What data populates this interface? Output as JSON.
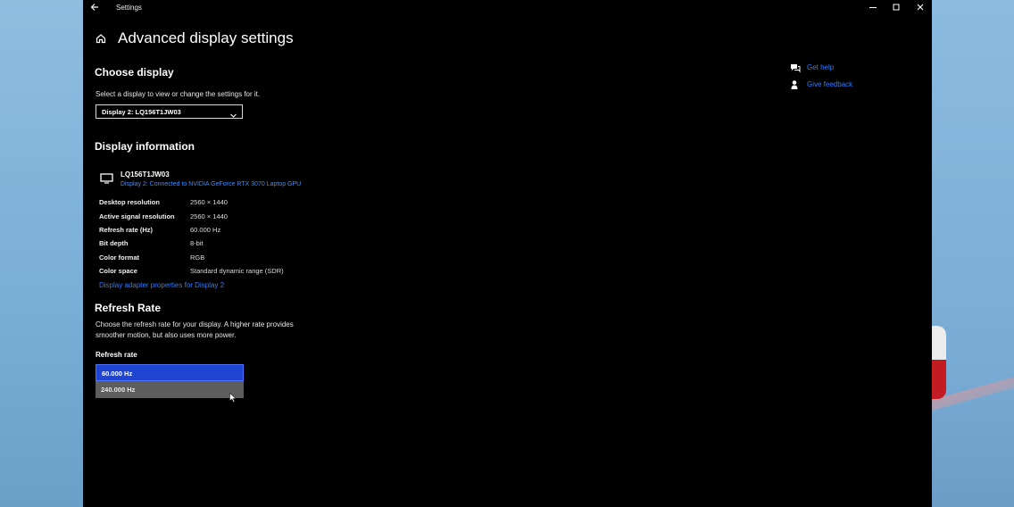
{
  "window": {
    "title": "Settings"
  },
  "page": {
    "title": "Advanced display settings"
  },
  "choose_display": {
    "heading": "Choose display",
    "instruction": "Select a display to view or change the settings for it.",
    "selected": "Display 2: LQ156T1JW03"
  },
  "display_info": {
    "heading": "Display information",
    "monitor_name": "LQ156T1JW03",
    "connection": "Display 2: Connected to NVIDIA GeForce RTX 3070 Laptop GPU",
    "rows": [
      {
        "label": "Desktop resolution",
        "value": "2560 × 1440"
      },
      {
        "label": "Active signal resolution",
        "value": "2560 × 1440"
      },
      {
        "label": "Refresh rate (Hz)",
        "value": "60.000 Hz"
      },
      {
        "label": "Bit depth",
        "value": "8-bit"
      },
      {
        "label": "Color format",
        "value": "RGB"
      },
      {
        "label": "Color space",
        "value": "Standard dynamic range (SDR)"
      }
    ],
    "adapter_link": "Display adapter properties for Display 2"
  },
  "refresh_rate": {
    "heading": "Refresh Rate",
    "description_line1": "Choose the refresh rate for your display. A higher rate provides",
    "description_line2": "smoother motion, but also uses more power.",
    "label": "Refresh rate",
    "options": [
      "60.000 Hz",
      "240.000 Hz"
    ],
    "selected": "60.000 Hz"
  },
  "help": {
    "get_help": "Get help",
    "give_feedback": "Give feedback"
  },
  "icons": {
    "back": "back-arrow-icon",
    "home": "home-icon",
    "monitor": "monitor-icon",
    "chevron": "chevron-down-icon",
    "help": "help-chat-icon",
    "feedback": "feedback-icon",
    "minimize": "minimize-icon",
    "maximize": "maximize-icon",
    "close": "close-icon"
  },
  "colors": {
    "link": "#2f7dff",
    "selected": "#1f45d2",
    "background": "#000000"
  }
}
